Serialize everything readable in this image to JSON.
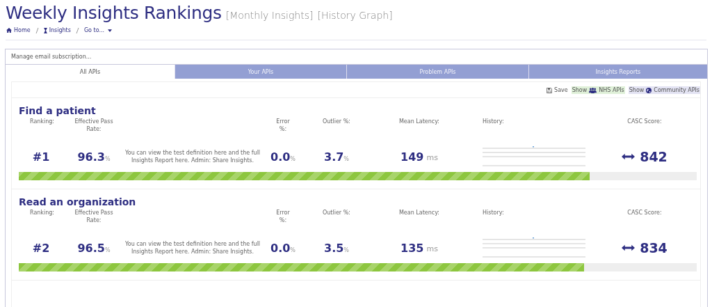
{
  "page": {
    "title": "Weekly Insights Rankings",
    "links": [
      "[Monthly Insights]",
      "[History Graph]"
    ]
  },
  "breadcrumbs": [
    {
      "label": "Home",
      "kind": "home"
    },
    {
      "label": "Insights",
      "kind": "insights"
    },
    {
      "label": "Go to...",
      "kind": "dropdown"
    }
  ],
  "subscription": {
    "label": "Manage email subscription..."
  },
  "tabs": [
    {
      "label": "All APIs",
      "selected": true
    },
    {
      "label": "Your APIs",
      "selected": false
    },
    {
      "label": "Problem APIs",
      "selected": false
    },
    {
      "label": "Insights Reports",
      "selected": false
    }
  ],
  "toolbar": {
    "save": "Save",
    "filters": [
      {
        "show": "Show",
        "label": "NHS APIs",
        "kind": "nhs",
        "color": "#dff0d8"
      },
      {
        "show": "Show",
        "label": "Community APIs",
        "kind": "community",
        "color": "#e3e3f3"
      }
    ]
  },
  "apis": [
    {
      "name": "Find a patient",
      "labels": [
        "Ranking:",
        "Effective Pass Rate:",
        "Error %:",
        "Outlier %:",
        "Mean Latency:",
        "History:",
        "CASC Score:"
      ],
      "ranking": "#1",
      "pass_rate": "96.3",
      "pass_unit": "%",
      "description": "You can view the test definition here and the full Insights Report here. Admin: Share Insights.",
      "error": "0.0",
      "error_unit": "%",
      "outlier": "3.7",
      "outlier_unit": "%",
      "latency": "149",
      "latency_unit": "ms",
      "score": "842",
      "level": 0.842
    },
    {
      "name": "Read an organization",
      "labels": [
        "Ranking:",
        "Effective Pass Rate:",
        "Error %:",
        "Outlier %:",
        "Mean Latency:",
        "History:",
        "CASC Score:"
      ],
      "ranking": "#2",
      "pass_rate": "96.5",
      "pass_unit": "%",
      "description": "You can view the test definition here and the full Insights Report here. Admin: Share Insights.",
      "error": "0.0",
      "error_unit": "%",
      "outlier": "3.5",
      "outlier_unit": "%",
      "latency": "135",
      "latency_unit": "ms",
      "score": "834",
      "level": 0.834
    }
  ]
}
